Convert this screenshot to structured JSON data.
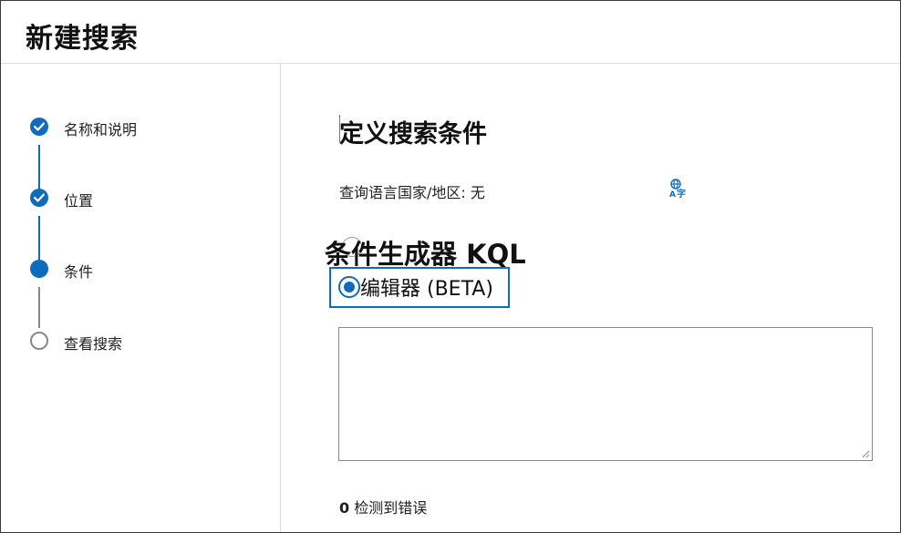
{
  "header": {
    "title": "新建搜索"
  },
  "steps": [
    {
      "label": "名称和说明",
      "state": "done"
    },
    {
      "label": "位置",
      "state": "done"
    },
    {
      "label": "条件",
      "state": "current"
    },
    {
      "label": "查看搜索",
      "state": "pending"
    }
  ],
  "main": {
    "section_title": "定义搜索条件",
    "query_language": "查询语言国家/地区: 无",
    "translate_icon": "translate-icon",
    "builder_heading": "条件生成器 KQL",
    "editor_option_label": "编辑器 (BETA)",
    "editor_selected": true,
    "kql_value": "",
    "error_count": "0",
    "error_text": "检测到错误"
  },
  "colors": {
    "accent": "#0f6cbd",
    "pending": "#8a8886",
    "border": "#e1dfdd"
  }
}
